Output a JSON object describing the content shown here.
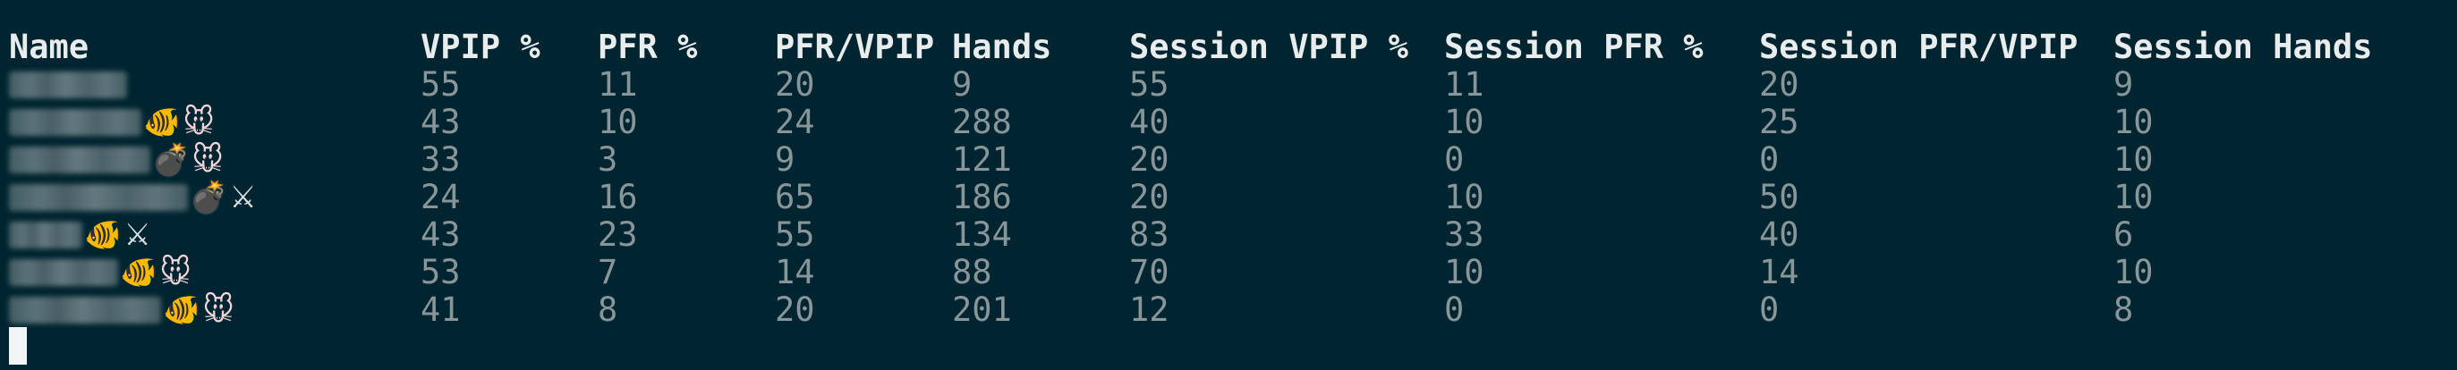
{
  "table": {
    "headers": [
      "Name",
      "VPIP %",
      "PFR %",
      "PFR/VPIP",
      "Hands",
      "Session VPIP %",
      "Session PFR %",
      "Session PFR/VPIP",
      "Session Hands"
    ],
    "rows": [
      {
        "icons": [],
        "values": [
          "55",
          "11",
          "20",
          "9",
          "55",
          "11",
          "20",
          "9"
        ]
      },
      {
        "icons": [
          "fish-icon",
          "mouse-icon"
        ],
        "values": [
          "43",
          "10",
          "24",
          "288",
          "40",
          "10",
          "25",
          "10"
        ]
      },
      {
        "icons": [
          "bomb-icon",
          "mouse-icon"
        ],
        "values": [
          "33",
          "3",
          "9",
          "121",
          "20",
          "0",
          "0",
          "10"
        ]
      },
      {
        "icons": [
          "bomb-icon",
          "swords-icon"
        ],
        "values": [
          "24",
          "16",
          "65",
          "186",
          "20",
          "10",
          "50",
          "10"
        ]
      },
      {
        "icons": [
          "fish-icon",
          "swords-icon"
        ],
        "values": [
          "43",
          "23",
          "55",
          "134",
          "83",
          "33",
          "40",
          "6"
        ]
      },
      {
        "icons": [
          "fish-icon",
          "mouse-icon"
        ],
        "values": [
          "53",
          "7",
          "14",
          "88",
          "70",
          "10",
          "14",
          "10"
        ]
      },
      {
        "icons": [
          "fish-icon",
          "mouse-icon"
        ],
        "values": [
          "41",
          "8",
          "20",
          "201",
          "12",
          "0",
          "0",
          "8"
        ]
      }
    ]
  },
  "icon_glyphs": {
    "fish-icon": "🐠",
    "mouse-icon": "🐭",
    "bomb-icon": "💣",
    "swords-icon": "⚔"
  },
  "colors": {
    "background": "#012530",
    "header_text": "#e8ecec",
    "body_text": "#889599",
    "cursor": "#f2f5f5"
  }
}
